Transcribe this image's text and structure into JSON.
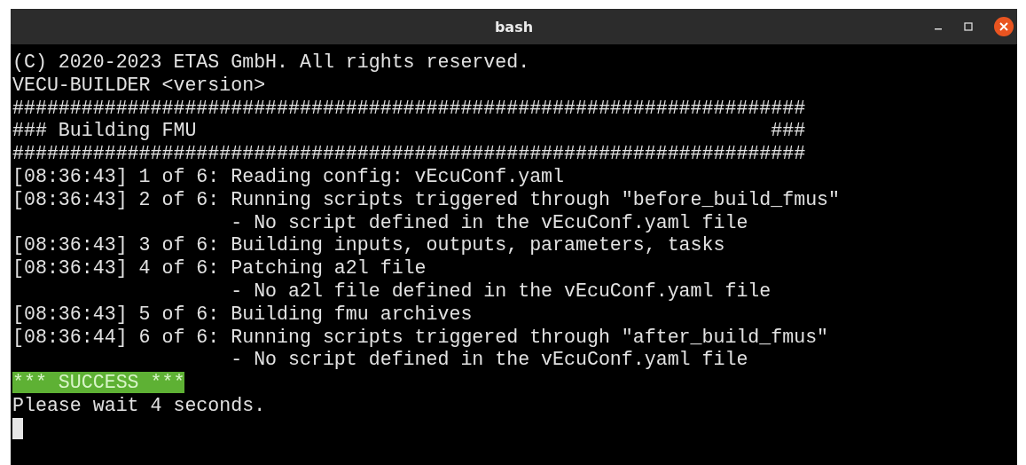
{
  "window": {
    "title": "bash"
  },
  "terminal": {
    "lines": [
      {
        "kind": "text",
        "text": "(C) 2020-2023 ETAS GmbH. All rights reserved."
      },
      {
        "kind": "text",
        "text": "VECU-BUILDER <version>"
      },
      {
        "kind": "text",
        "text": "#####################################################################"
      },
      {
        "kind": "text",
        "text": "### Building FMU                                                  ###"
      },
      {
        "kind": "text",
        "text": "#####################################################################"
      },
      {
        "kind": "text",
        "text": "[08:36:43] 1 of 6: Reading config: vEcuConf.yaml"
      },
      {
        "kind": "text",
        "text": "[08:36:43] 2 of 6: Running scripts triggered through \"before_build_fmus\""
      },
      {
        "kind": "text",
        "text": "                   - No script defined in the vEcuConf.yaml file"
      },
      {
        "kind": "text",
        "text": "[08:36:43] 3 of 6: Building inputs, outputs, parameters, tasks"
      },
      {
        "kind": "text",
        "text": "[08:36:43] 4 of 6: Patching a2l file"
      },
      {
        "kind": "text",
        "text": "                   - No a2l file defined in the vEcuConf.yaml file"
      },
      {
        "kind": "text",
        "text": "[08:36:43] 5 of 6: Building fmu archives"
      },
      {
        "kind": "text",
        "text": "[08:36:44] 6 of 6: Running scripts triggered through \"after_build_fmus\""
      },
      {
        "kind": "text",
        "text": "                   - No script defined in the vEcuConf.yaml file"
      },
      {
        "kind": "highlight",
        "text": "*** SUCCESS ***"
      },
      {
        "kind": "text",
        "text": "Please wait 4 seconds."
      }
    ],
    "cursor_visible": true
  }
}
